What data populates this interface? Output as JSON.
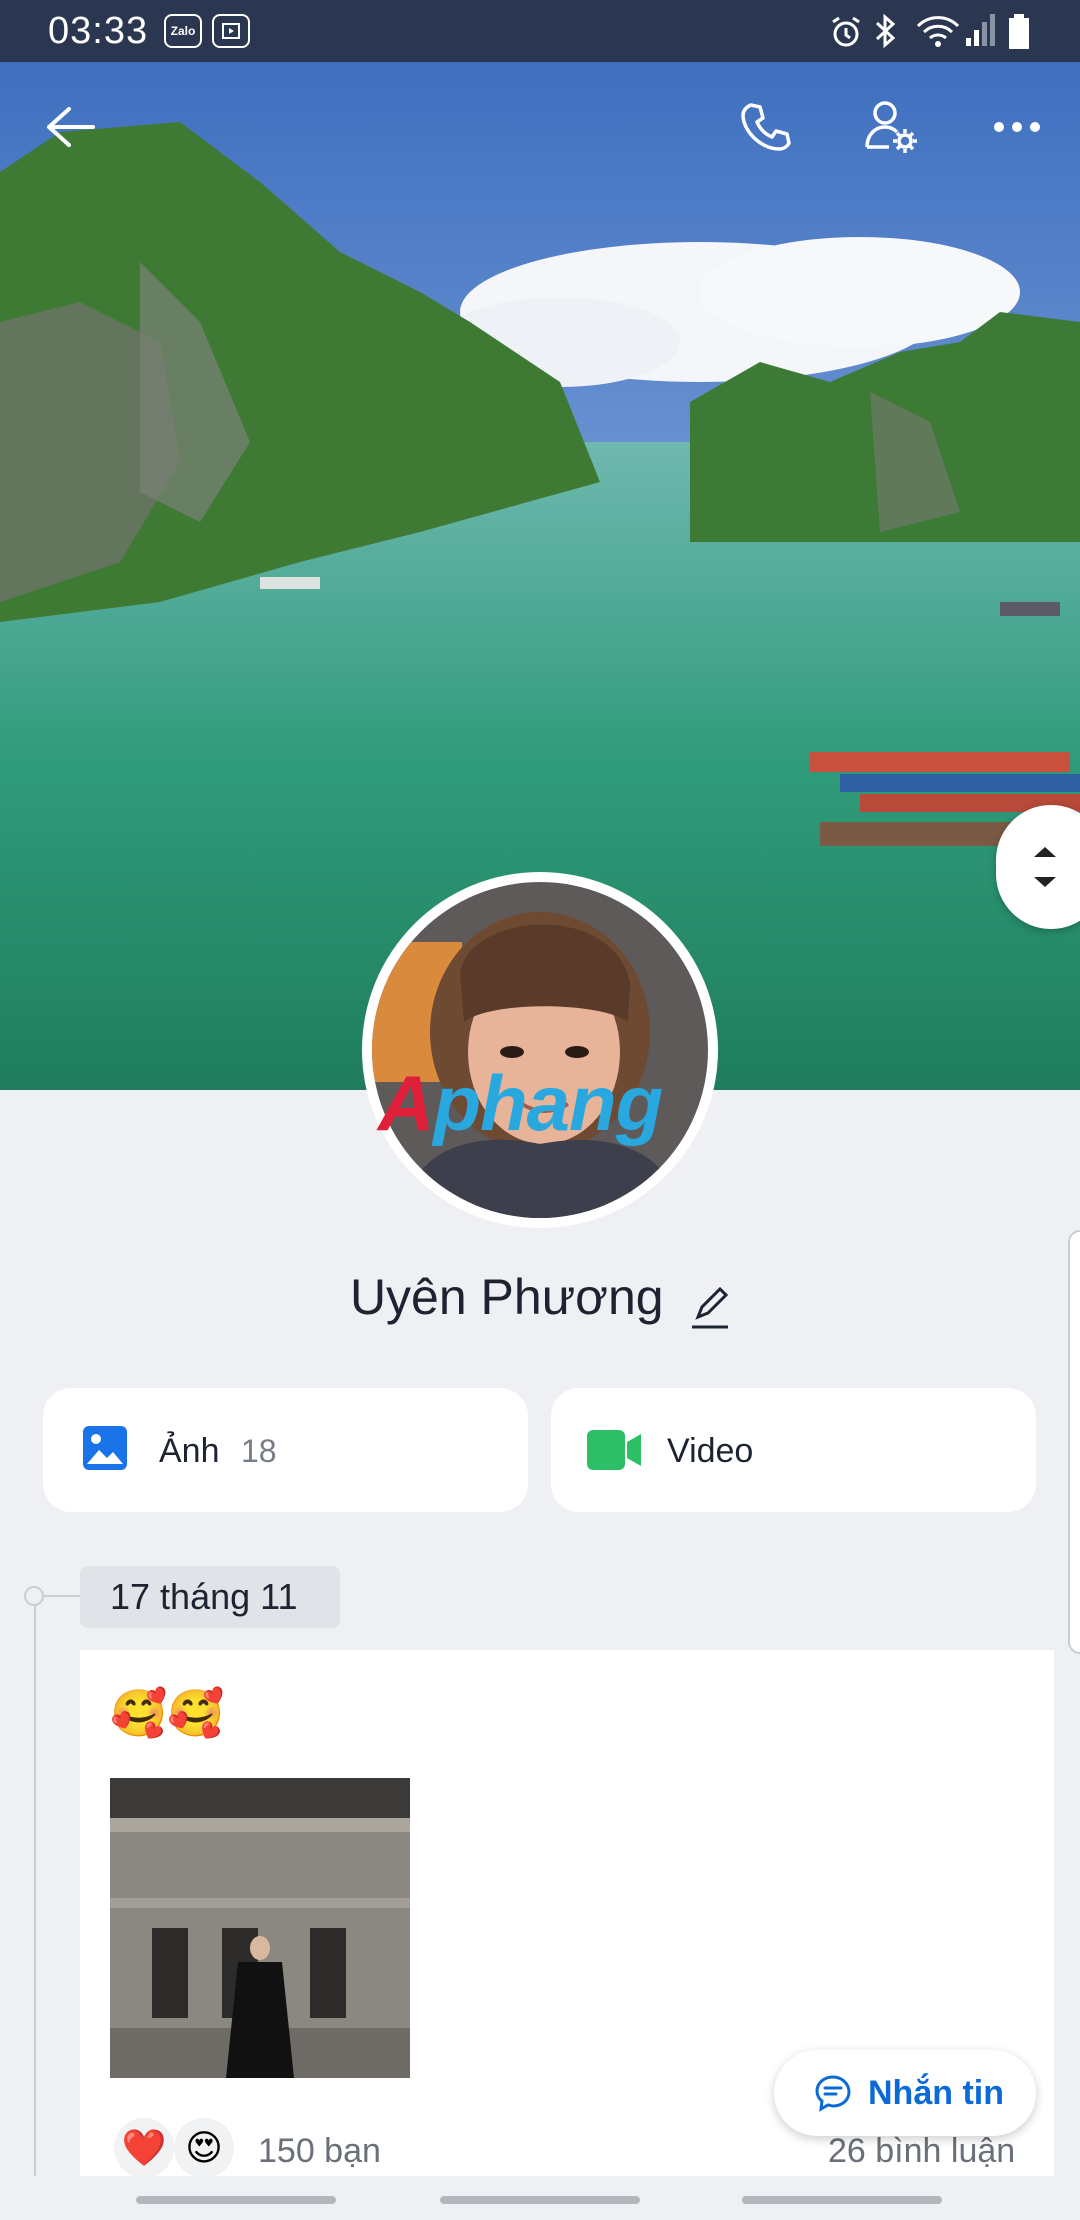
{
  "status_bar": {
    "time": "03:33",
    "app_icons": [
      {
        "icon": "zalo-icon",
        "text": "Zalo"
      },
      {
        "icon": "video-app-icon"
      }
    ],
    "system_icons": [
      "alarm-icon",
      "bluetooth-icon",
      "wifi-icon",
      "signal-icon",
      "battery-icon"
    ]
  },
  "header": {
    "back_icon": "arrow-left-icon",
    "call_icon": "phone-icon",
    "settings_icon": "user-settings-icon",
    "more_icon": "more-icon"
  },
  "profile": {
    "name": "Uyên Phương",
    "edit_icon": "pencil-icon",
    "watermark": {
      "part1": "A",
      "part2": "phang"
    }
  },
  "tiles": [
    {
      "label": "Ảnh",
      "count": "18",
      "icon": "image-icon"
    },
    {
      "label": "Video",
      "icon": "video-icon"
    }
  ],
  "timeline": {
    "date": "17 tháng 11",
    "post": {
      "text": "🥰🥰",
      "reactions": [
        "❤️",
        "😍"
      ],
      "reaction_count": "150 bạn",
      "comment_count": "26 bình luận"
    }
  },
  "message_button": {
    "label": "Nhắn tin",
    "icon": "chat-icon"
  },
  "colors": {
    "accent": "#0b6ad6",
    "status_bar": "#2b3650",
    "image_icon": "#1a73e8",
    "video_icon": "#2dbf66",
    "background": "#eff0f4"
  }
}
